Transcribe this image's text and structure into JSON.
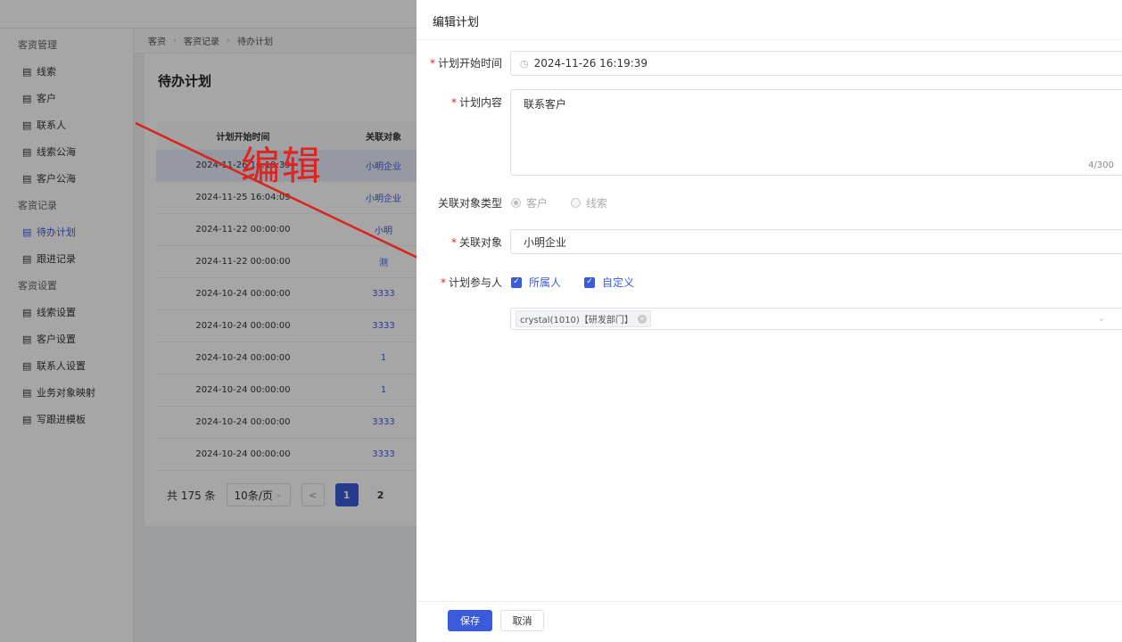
{
  "sidebar": {
    "groups": [
      {
        "title": "客资管理",
        "items": [
          {
            "label": "线索",
            "icon": "doc-icon"
          },
          {
            "label": "客户",
            "icon": "doc-icon"
          },
          {
            "label": "联系人",
            "icon": "doc-icon"
          },
          {
            "label": "线索公海",
            "icon": "doc-icon"
          },
          {
            "label": "客户公海",
            "icon": "doc-icon"
          }
        ]
      },
      {
        "title": "客资记录",
        "items": [
          {
            "label": "待办计划",
            "icon": "doc-icon",
            "active": true
          },
          {
            "label": "跟进记录",
            "icon": "doc-icon"
          }
        ]
      },
      {
        "title": "客资设置",
        "items": [
          {
            "label": "线索设置",
            "icon": "doc-icon"
          },
          {
            "label": "客户设置",
            "icon": "doc-icon"
          },
          {
            "label": "联系人设置",
            "icon": "doc-icon"
          },
          {
            "label": "业务对象映射",
            "icon": "doc-icon"
          },
          {
            "label": "写跟进模板",
            "icon": "doc-icon"
          }
        ]
      }
    ]
  },
  "breadcrumb": [
    "客资",
    "客资记录",
    "待办计划"
  ],
  "page": {
    "title": "待办计划"
  },
  "table": {
    "headers": {
      "time": "计划开始时间",
      "object": "关联对象"
    },
    "rows": [
      {
        "time": "2024-11-26 16:19:39",
        "object": "小明企业"
      },
      {
        "time": "2024-11-25 16:04:09",
        "object": "小明企业"
      },
      {
        "time": "2024-11-22 00:00:00",
        "object": "小明"
      },
      {
        "time": "2024-11-22 00:00:00",
        "object": "测"
      },
      {
        "time": "2024-10-24 00:00:00",
        "object": "3333"
      },
      {
        "time": "2024-10-24 00:00:00",
        "object": "3333"
      },
      {
        "time": "2024-10-24 00:00:00",
        "object": "1"
      },
      {
        "time": "2024-10-24 00:00:00",
        "object": "1"
      },
      {
        "time": "2024-10-24 00:00:00",
        "object": "3333"
      },
      {
        "time": "2024-10-24 00:00:00",
        "object": "3333"
      }
    ]
  },
  "pager": {
    "total": "共 175 条",
    "page_size": "10条/页",
    "prev": "<",
    "current": "1",
    "next_page": "2"
  },
  "annotation": {
    "text": "编辑",
    "color": "#e0231f"
  },
  "drawer": {
    "title": "编辑计划",
    "fields": {
      "start_time": {
        "label": "计划开始时间",
        "value": "2024-11-26 16:19:39"
      },
      "content": {
        "label": "计划内容",
        "value": "联系客户",
        "count": "4/300"
      },
      "object_type": {
        "label": "关联对象类型",
        "options": [
          "客户",
          "线索"
        ],
        "selected": "客户"
      },
      "object": {
        "label": "关联对象",
        "value": "小明企业"
      },
      "participants": {
        "label": "计划参与人",
        "options": [
          "所属人",
          "自定义"
        ],
        "tag": "crystal(1010)【研发部门】"
      }
    },
    "buttons": {
      "save": "保存",
      "cancel": "取消"
    }
  },
  "colors": {
    "accent": "#3b5bdb",
    "required": "#e0231f"
  }
}
